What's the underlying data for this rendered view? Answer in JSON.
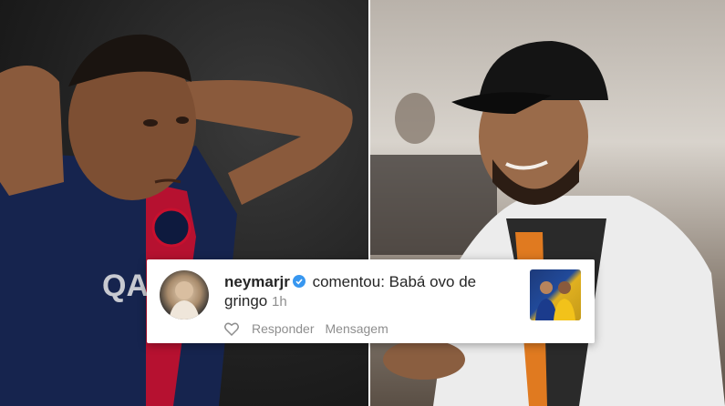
{
  "post": {
    "username": "neymarjr",
    "verified": true,
    "comment_text": "comentou: Babá ovo de gringo",
    "time": "1h",
    "actions": {
      "reply_label": "Responder",
      "message_label": "Mensagem"
    },
    "avatar_icon": "profile-photo",
    "thumbnail_icon": "post-thumbnail",
    "verified_color": "#3897f0"
  }
}
